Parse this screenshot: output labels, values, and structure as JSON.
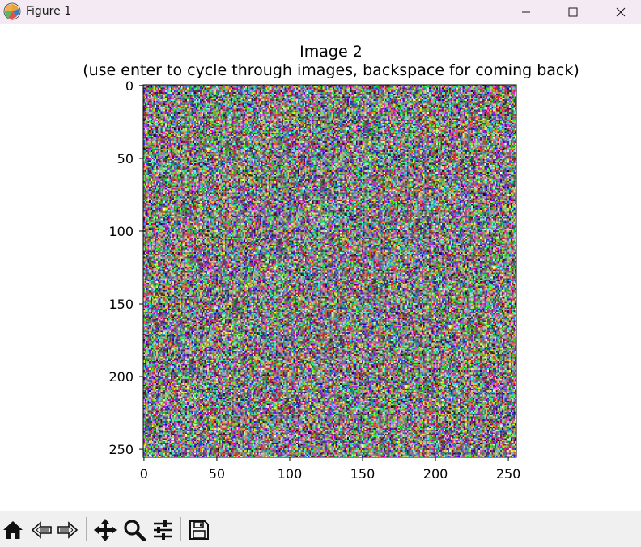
{
  "window": {
    "title": "Figure 1"
  },
  "icons": {
    "app": "matplotlib-logo-icon",
    "minimize": "minimize-icon",
    "maximize": "maximize-icon",
    "close": "close-icon",
    "home": "home-icon",
    "back": "back-arrow-icon",
    "forward": "forward-arrow-icon",
    "pan": "move-arrows-icon",
    "zoom": "magnifier-icon",
    "configure": "sliders-icon",
    "save": "floppy-disk-icon"
  },
  "chart_data": {
    "type": "heatmap",
    "title": "Image 2",
    "subtitle": "(use enter to cycle through images, backspace for coming back)",
    "image_size": [
      256,
      256
    ],
    "content": "random RGB noise",
    "xlim": [
      -0.5,
      255.5
    ],
    "ylim": [
      255.5,
      -0.5
    ],
    "x_ticks": [
      0,
      50,
      100,
      150,
      200,
      250
    ],
    "y_ticks": [
      0,
      50,
      100,
      150,
      200,
      250
    ],
    "x_tick_labels": [
      "0",
      "50",
      "100",
      "150",
      "200",
      "250"
    ],
    "y_tick_labels": [
      "0",
      "50",
      "100",
      "150",
      "200",
      "250"
    ],
    "grid": false
  }
}
